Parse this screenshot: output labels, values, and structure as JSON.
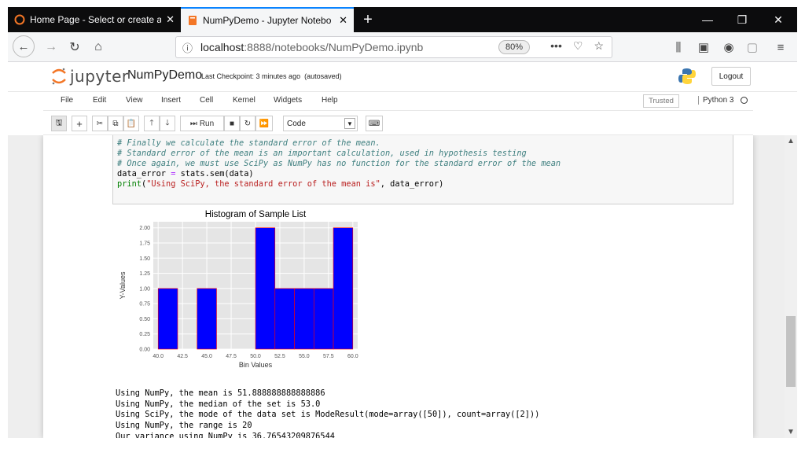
{
  "browser": {
    "tabs": [
      {
        "title": "Home Page - Select or create a",
        "close": "✕"
      },
      {
        "title": "NumPyDemo - Jupyter Notebo",
        "close": "✕"
      }
    ],
    "new_tab": "+",
    "url_host": "localhost",
    "url_rest": ":8888/notebooks/NumPyDemo.ipynb",
    "zoom": "80%"
  },
  "jupyter": {
    "logo_text": "jupyter",
    "notebook_name": "NumPyDemo",
    "checkpoint": "Last Checkpoint: 3 minutes ago",
    "autosave": "(autosaved)",
    "logout": "Logout",
    "menu": [
      "File",
      "Edit",
      "View",
      "Insert",
      "Cell",
      "Kernel",
      "Widgets",
      "Help"
    ],
    "trusted": "Trusted",
    "kernel": "Python 3",
    "run_label": "Run",
    "cell_type": "Code"
  },
  "code": {
    "line1": "# Finally we calculate the standard error of the mean.",
    "line2": "# Standard error of the mean is an important calculation, used in hypothesis testing",
    "line3": "# Once again, we must use SciPy as NumPy has no function for the standard error of the mean",
    "line4_a": "data_error ",
    "line4_op": "=",
    "line4_b": " stats.sem(data)",
    "line5_kw": "print",
    "line5_a": "(",
    "line5_str": "\"Using SciPy, the standard error of the mean is\"",
    "line5_b": ", data_error)"
  },
  "output": [
    "Using NumPy, the mean is 51.888888888888886",
    "Using NumPy, the median of the set is 53.0",
    "Using SciPy, the mode of the data set is ModeResult(mode=array([50]), count=array([2]))",
    "Using NumPy, the range is 20",
    "Our variance using NumPy is 36.76543209876544"
  ],
  "chart_data": {
    "type": "bar",
    "title": "Histogram of Sample List",
    "xlabel": "Bin Values",
    "ylabel": "Y-Values",
    "xlim": [
      39.5,
      60.5
    ],
    "ylim": [
      0,
      2.1
    ],
    "xticks": [
      "40.0",
      "42.5",
      "45.0",
      "47.5",
      "50.0",
      "52.5",
      "55.0",
      "57.5",
      "60.0"
    ],
    "yticks": [
      "0.00",
      "0.25",
      "0.50",
      "0.75",
      "1.00",
      "1.25",
      "1.50",
      "1.75",
      "2.00"
    ],
    "bins": [
      {
        "x0": 40,
        "x1": 42,
        "value": 1
      },
      {
        "x0": 42,
        "x1": 44,
        "value": 0
      },
      {
        "x0": 44,
        "x1": 46,
        "value": 1
      },
      {
        "x0": 46,
        "x1": 48,
        "value": 0
      },
      {
        "x0": 48,
        "x1": 50,
        "value": 0
      },
      {
        "x0": 50,
        "x1": 52,
        "value": 2
      },
      {
        "x0": 52,
        "x1": 54,
        "value": 1
      },
      {
        "x0": 54,
        "x1": 56,
        "value": 1
      },
      {
        "x0": 56,
        "x1": 58,
        "value": 1
      },
      {
        "x0": 58,
        "x1": 60,
        "value": 2
      }
    ],
    "bar_color": "#0000ff",
    "edge_color": "#ff0000",
    "background": "#e5e5e5",
    "grid": true
  }
}
